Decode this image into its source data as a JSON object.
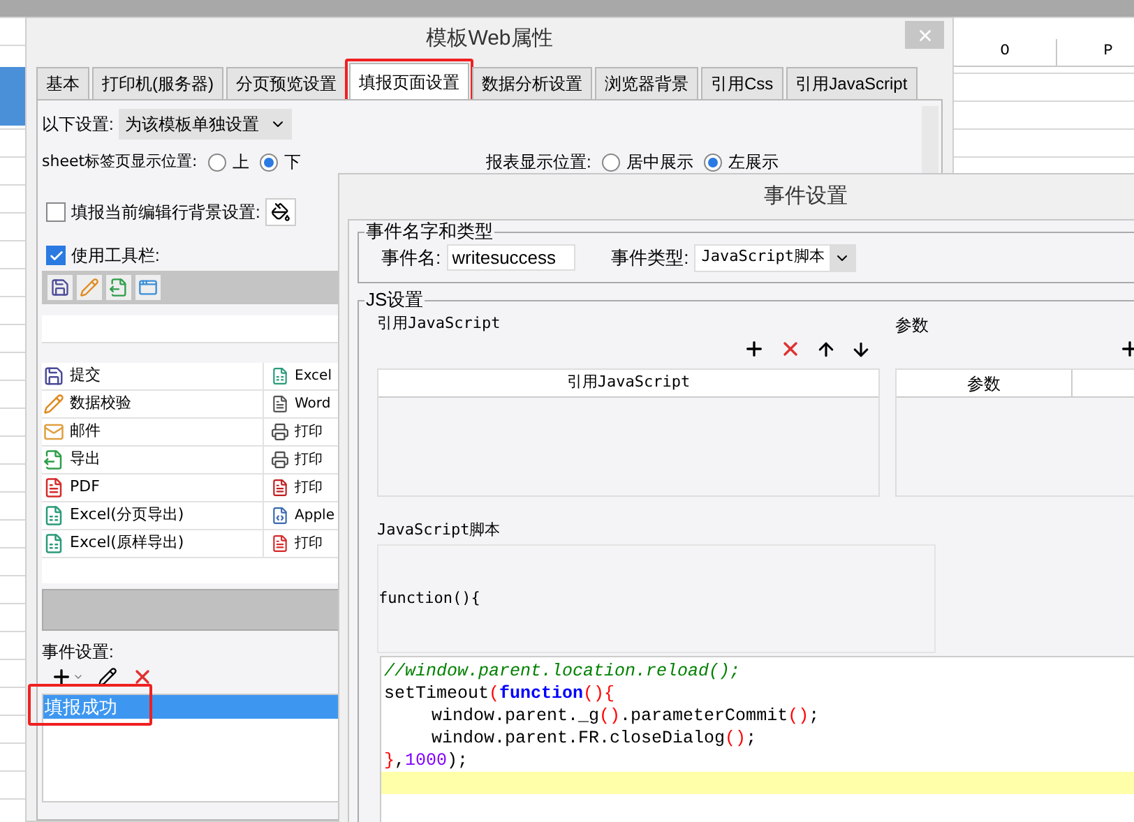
{
  "spreadsheet": {
    "columns": [
      "O",
      "P"
    ]
  },
  "main_dialog": {
    "title": "模板Web属性",
    "tabs": [
      {
        "label": "基本",
        "selected": false,
        "marked": false
      },
      {
        "label": "打印机(服务器)",
        "selected": false,
        "marked": false
      },
      {
        "label": "分页预览设置",
        "selected": false,
        "marked": false
      },
      {
        "label": "填报页面设置",
        "selected": true,
        "marked": true
      },
      {
        "label": "数据分析设置",
        "selected": false,
        "marked": false
      },
      {
        "label": "浏览器背景",
        "selected": false,
        "marked": false
      },
      {
        "label": "引用Css",
        "selected": false,
        "marked": false
      },
      {
        "label": "引用JavaScript",
        "selected": false,
        "marked": false
      }
    ],
    "template_setting": {
      "label": "以下设置:",
      "value": "为该模板单独设置"
    },
    "sheet_tab_position": {
      "label": "sheet标签页显示位置:",
      "options": [
        {
          "label": "上",
          "selected": false
        },
        {
          "label": "下",
          "selected": true
        }
      ]
    },
    "report_position": {
      "label": "报表显示位置:",
      "options": [
        {
          "label": "居中展示",
          "selected": false
        },
        {
          "label": "左展示",
          "selected": true
        }
      ]
    },
    "row_background": {
      "label": "填报当前编辑行背景设置:",
      "checked": false
    },
    "use_toolbar": {
      "label": "使用工具栏:",
      "checked": true
    },
    "toolbar_icons": [
      {
        "kind": "save"
      },
      {
        "kind": "verify"
      },
      {
        "kind": "export"
      },
      {
        "kind": "blank"
      }
    ],
    "toolbar_items": [
      {
        "left": {
          "kind": "save",
          "label": "提交"
        },
        "right": {
          "kind": "excel",
          "label": "Excel"
        }
      },
      {
        "left": {
          "kind": "verify",
          "label": "数据校验"
        },
        "right": {
          "kind": "word",
          "label": "Word"
        }
      },
      {
        "left": {
          "kind": "mail",
          "label": "邮件"
        },
        "right": {
          "kind": "print",
          "label": "打印"
        }
      },
      {
        "left": {
          "kind": "export",
          "label": "导出"
        },
        "right": {
          "kind": "print",
          "label": "打印"
        }
      },
      {
        "left": {
          "kind": "pdf",
          "label": "PDF"
        },
        "right": {
          "kind": "flash",
          "label": "打印"
        }
      },
      {
        "left": {
          "kind": "excel",
          "label": "Excel(分页导出)"
        },
        "right": {
          "kind": "applet",
          "label": "Apple"
        }
      },
      {
        "left": {
          "kind": "excel",
          "label": "Excel(原样导出)"
        },
        "right": {
          "kind": "pdf",
          "label": "打印"
        }
      }
    ],
    "events": {
      "label": "事件设置:",
      "items": [
        {
          "label": "填报成功",
          "selected": true,
          "marked": true
        }
      ]
    }
  },
  "event_dialog": {
    "title": "事件设置",
    "name_group": {
      "legend": "事件名字和类型",
      "name_label": "事件名:",
      "name_value": "writesuccess",
      "type_label": "事件类型:",
      "type_value": "JavaScript脚本"
    },
    "js_group": {
      "legend": "JS设置",
      "ref_section": "引用JavaScript",
      "ref_column": "引用JavaScript",
      "param_section": "参数",
      "param_column": "参数",
      "script_section": "JavaScript脚本",
      "function_header": "function(){",
      "code": [
        {
          "indented": false,
          "current": false,
          "tokens": [
            {
              "kind": "comment",
              "text": "//window.parent.location.reload();"
            }
          ]
        },
        {
          "indented": false,
          "current": false,
          "tokens": [
            {
              "kind": "plain",
              "text": "setTimeout"
            },
            {
              "kind": "paren",
              "text": "("
            },
            {
              "kind": "keyword",
              "text": "function"
            },
            {
              "kind": "paren",
              "text": "(){"
            }
          ]
        },
        {
          "indented": true,
          "current": false,
          "tokens": [
            {
              "kind": "plain",
              "text": "window.parent._g"
            },
            {
              "kind": "paren",
              "text": "()"
            },
            {
              "kind": "plain",
              "text": ".parameterCommit"
            },
            {
              "kind": "paren",
              "text": "()"
            },
            {
              "kind": "plain",
              "text": ";"
            }
          ]
        },
        {
          "indented": true,
          "current": false,
          "tokens": [
            {
              "kind": "plain",
              "text": "window.parent.FR.closeDialog"
            },
            {
              "kind": "paren",
              "text": "()"
            },
            {
              "kind": "plain",
              "text": ";"
            }
          ]
        },
        {
          "indented": false,
          "current": false,
          "tokens": [
            {
              "kind": "paren",
              "text": "}"
            },
            {
              "kind": "plain",
              "text": ","
            },
            {
              "kind": "number",
              "text": "1000"
            },
            {
              "kind": "plain",
              "text": ");"
            }
          ]
        },
        {
          "indented": false,
          "current": true
        }
      ]
    }
  }
}
